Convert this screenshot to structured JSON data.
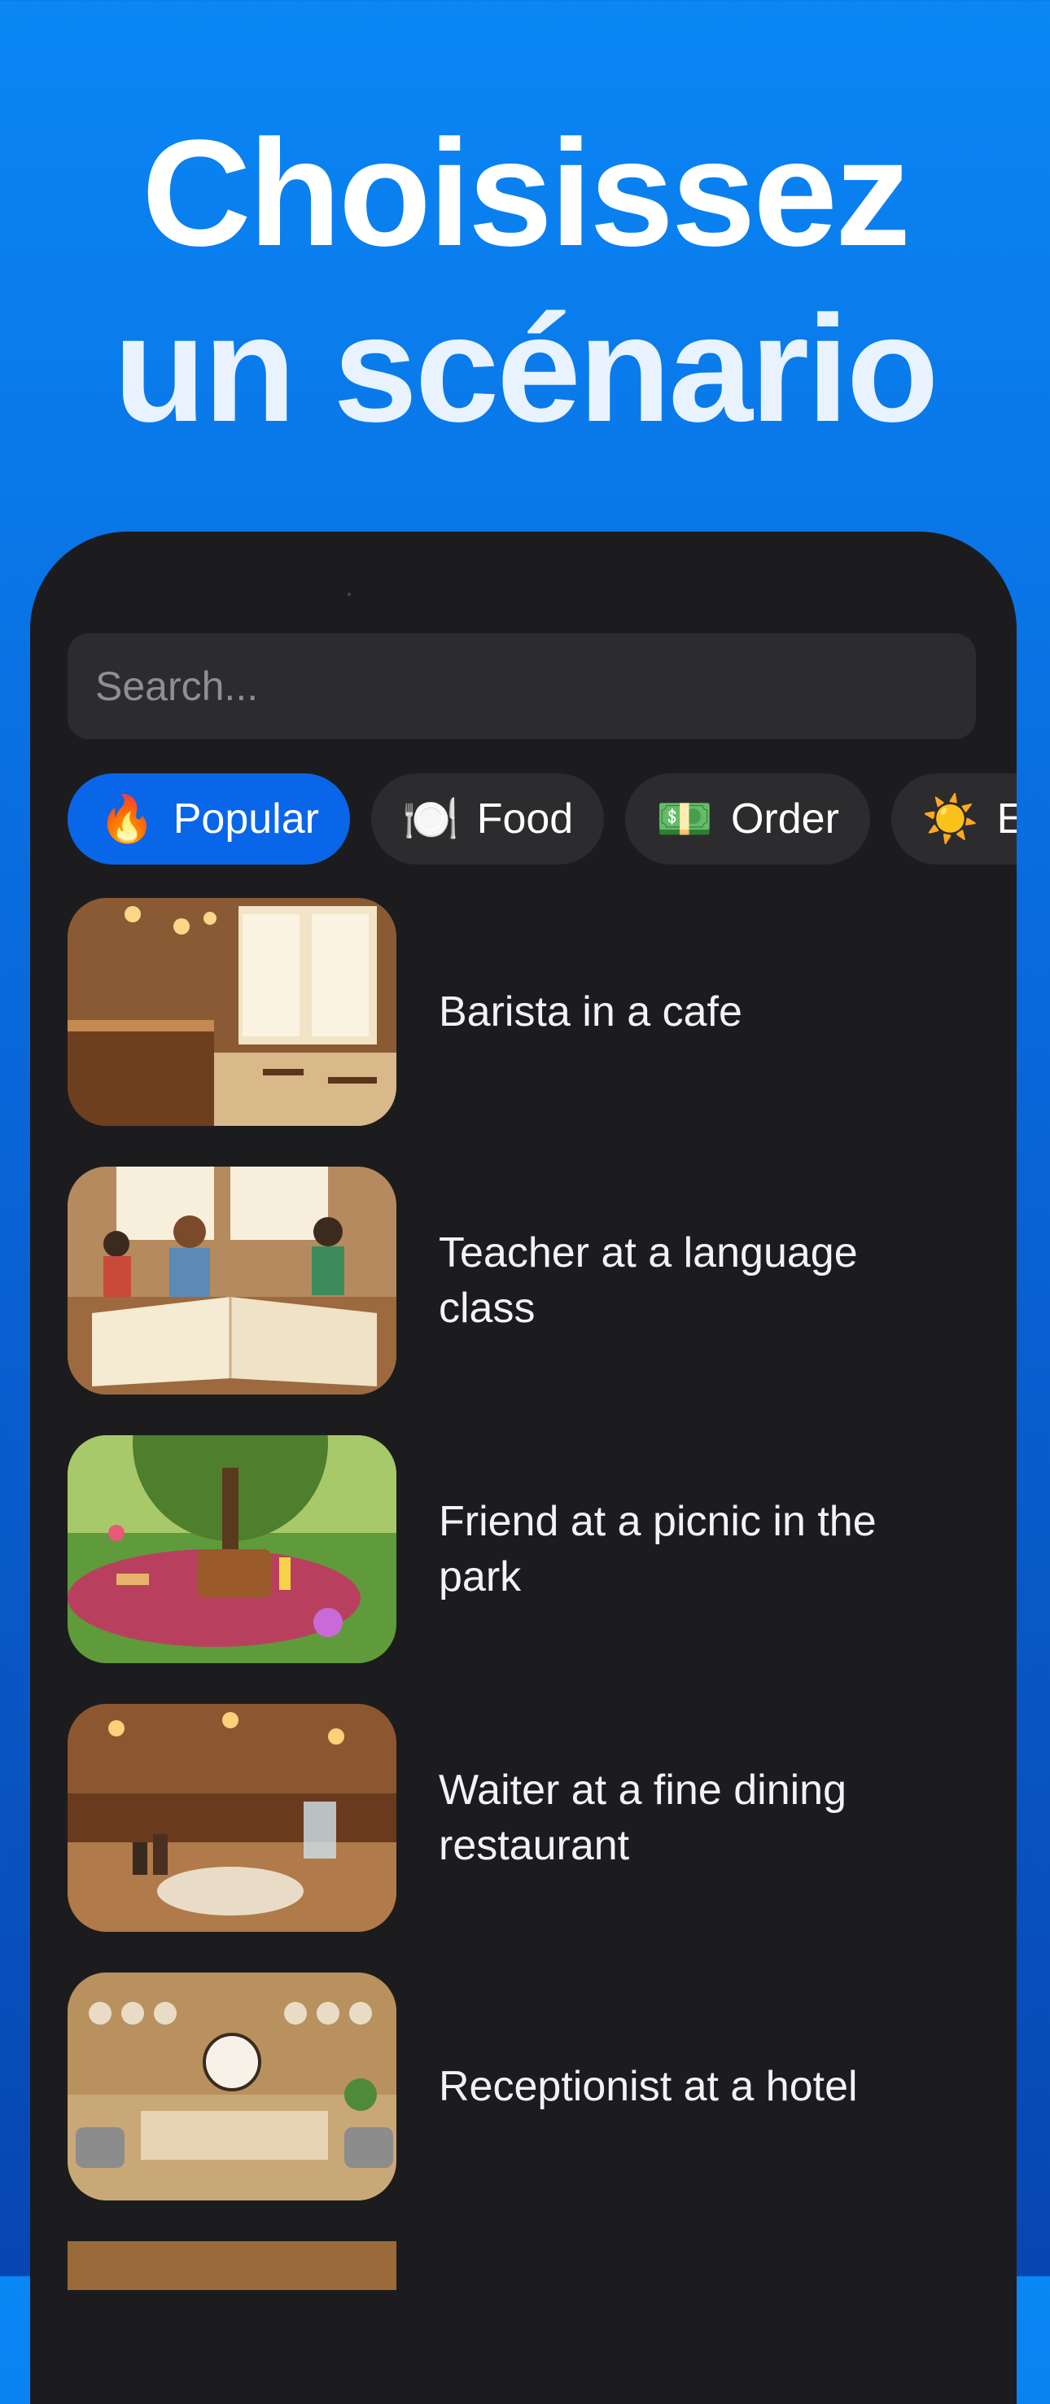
{
  "headline": {
    "line1": "Choisissez",
    "line2": "un scénario"
  },
  "search": {
    "placeholder": "Search..."
  },
  "chips": [
    {
      "icon": "🔥",
      "label": "Popular",
      "active": true
    },
    {
      "icon": "🍽️",
      "label": "Food"
    },
    {
      "icon": "💵",
      "label": "Order"
    },
    {
      "icon": "☀️",
      "label": "Ev"
    }
  ],
  "scenarios": [
    {
      "label": "Barista in a cafe"
    },
    {
      "label": "Teacher at a language class"
    },
    {
      "label": "Friend at a picnic in the park"
    },
    {
      "label": "Waiter at a fine dining restaurant"
    },
    {
      "label": "Receptionist at a hotel"
    }
  ]
}
